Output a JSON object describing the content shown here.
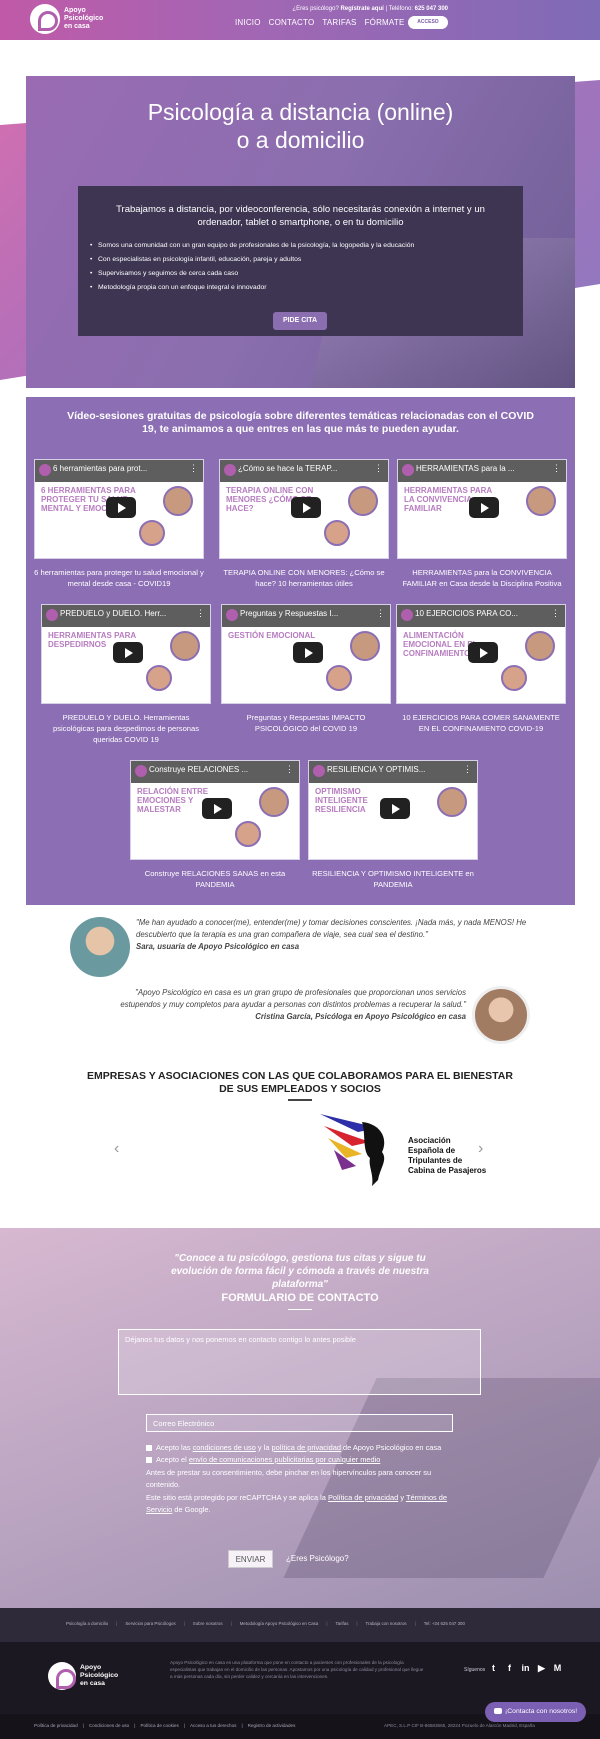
{
  "header": {
    "brand": "Apoyo Psicológico en casa",
    "topline_question": "¿Eres psicólogo?",
    "topline_register": "Regístrate aquí",
    "topline_phone_label": "| Teléfono:",
    "topline_phone": "625 047 300",
    "nav": [
      "INICIO",
      "CONTACTO",
      "TARIFAS",
      "FÓRMATE"
    ],
    "access_label": "ACCESO"
  },
  "hero": {
    "title_line1": "Psicología a distancia (online)",
    "title_line2": "o a domicilio",
    "intro": "Trabajamos a distancia, por videoconferencia, sólo necesitarás conexión a internet y un ordenador, tablet o smartphone, o en tu domicilio",
    "bullets": [
      "Somos una comunidad con un gran equipo de profesionales de la psicología, la logopedia y la educación",
      "Con especialistas en psicología infantil, educación, pareja y adultos",
      "Supervisamos y seguimos de cerca cada caso",
      "Metodología propia con un enfoque integral e innovador"
    ],
    "cta_label": "PIDE CITA"
  },
  "videos": {
    "heading": "Vídeo-sesiones gratuitas de psicología sobre diferentes temáticas relacionadas con el COVID 19, te animamos a que entres en las que más te pueden ayudar.",
    "items": [
      {
        "thumb_title": "6 herramientas para prot...",
        "thumb_text": "6 herramientas para proteger tu salud mental y emocional",
        "caption": "6 herramientas para proteger tu salud emocional y mental desde casa - COVID19"
      },
      {
        "thumb_title": "¿Cómo se hace la TERAP...",
        "thumb_text": "Terapia online con menores ¿Cómo se hace?",
        "caption": "TERAPIA ONLINE CON MENORES: ¿Cómo se hace? 10 herramientas útiles"
      },
      {
        "thumb_title": "HERRAMIENTAS para la ...",
        "thumb_text": "Herramientas para la convivencia familiar",
        "caption": "HERRAMIENTAS para la CONVIVENCIA FAMILIAR en Casa desde la Disciplina Positiva"
      },
      {
        "thumb_title": "PREDUELO y DUELO. Herr...",
        "thumb_text": "Herramientas para despedirnos",
        "caption": "PREDUELO Y DUELO. Herramientas psicológicas para despedirnos de personas queridas COVID 19"
      },
      {
        "thumb_title": "Preguntas y Respuestas I...",
        "thumb_text": "Gestión Emocional",
        "caption": "Preguntas y Respuestas IMPACTO PSICOLÓGICO del COVID 19"
      },
      {
        "thumb_title": "10 EJERCICIOS PARA CO...",
        "thumb_text": "Alimentación emocional en el confinamiento",
        "caption": "10 EJERCICIOS PARA COMER SANAMENTE EN EL CONFINAMIENTO COVID-19"
      },
      {
        "thumb_title": "Construye RELACIONES ...",
        "thumb_text": "Relación entre emociones y malestar",
        "caption": "Construye RELACIONES SANAS en esta PANDEMIA"
      },
      {
        "thumb_title": "RESILIENCIA Y OPTIMIS...",
        "thumb_text": "Optimismo inteligente resiliencia",
        "caption": "RESILIENCIA Y OPTIMISMO INTELIGENTE en PANDEMIA"
      }
    ]
  },
  "testimonials": [
    {
      "quote": "\"Me han ayudado a conocer(me), entender(me) y tomar decisiones conscientes. ¡Nada más, y nada MENOS! He descubierto que la terapia es una gran compañera de viaje, sea cual sea el destino.\"",
      "author": "Sara, usuaria de Apoyo Psicológico en casa"
    },
    {
      "quote": "\"Apoyo Psicológico en casa es un gran grupo de profesionales que proporcionan unos servicios estupendos y muy completos para ayudar a personas con distintos problemas a recuperar la salud.\"",
      "author": "Cristina García, Psicóloga en Apoyo Psicológico en casa"
    }
  ],
  "partners": {
    "title": "EMPRESAS Y ASOCIACIONES CON LAS QUE COLABORAMOS PARA EL BIENESTAR DE SUS EMPLEADOS Y SOCIOS",
    "logo_text": "Asociación Española de Tripulantes de Cabina de Pasajeros",
    "prev": "‹",
    "next": "›"
  },
  "contact": {
    "quote": "\"Conoce a tu psicólogo, gestiona tus citas y sigue tu evolución de forma fácil y cómoda a través de nuestra plataforma\"",
    "form_title": "FORMULARIO DE CONTACTO",
    "message_placeholder": "Déjanos tus datos y nos ponemos en contacto contigo lo antes posible",
    "email_placeholder": "Correo Electrónico",
    "check1_pre": "Acepto las",
    "check1_link1": "condiciones de uso",
    "check1_mid": "y la",
    "check1_link2": "política de privacidad",
    "check1_post": "de Apoyo Psicológico en casa",
    "check2_pre": "Acepto el",
    "check2_link": "envío de comunicaciones publicitarias por cualquier medio",
    "consent_note": "Antes de prestar su consentimiento, debe pinchar en los hipervínculos para conocer su contenido.",
    "recaptcha_pre": "Este sitio está protegido por reCAPTCHA y se aplica la",
    "recaptcha_link1": "Política de privacidad",
    "recaptcha_mid": "y",
    "recaptcha_link2": "Términos de Servicio",
    "recaptcha_post": "de Google.",
    "send_label": "ENVIAR",
    "psy_link": "¿Eres Psicólogo?"
  },
  "footer": {
    "links": [
      "Psicología a domicilio",
      "Servicios para Psicólogos",
      "Sobre nosotros",
      "Metodología Apoyo Psicológico en Casa",
      "Tarifas",
      "Trabaja con nosotros",
      "Tel: +34 625 047 300"
    ],
    "description": "Apoyo Psicológico en casa es una plataforma que pone en contacto a pacientes con profesionales de la psicología especialistas que trabajan en el domicilio de las personas. Apostamos por una psicología de calidad y profesional que llegue a más personas cada día, sin perder calidez y cercanía en las intervenciones.",
    "follow_label": "Síguenos",
    "social": [
      "twitter-icon",
      "facebook-icon",
      "linkedin-icon",
      "youtube-icon",
      "medium-icon"
    ],
    "legal": [
      "Política de privacidad",
      "Condiciones de uso",
      "Política de cookies",
      "Acceso a tus derechos",
      "Registro de actividades"
    ],
    "company": "APEC, S.L.P CIF B-86583665, 28224 Pozuelo de Alarcón Madrid, España",
    "chat_label": "¡Contacta con nosotros!"
  },
  "colors": {
    "accent": "#8c6eb4",
    "brand_pink": "#c05aa8",
    "dark": "#1c1822"
  }
}
